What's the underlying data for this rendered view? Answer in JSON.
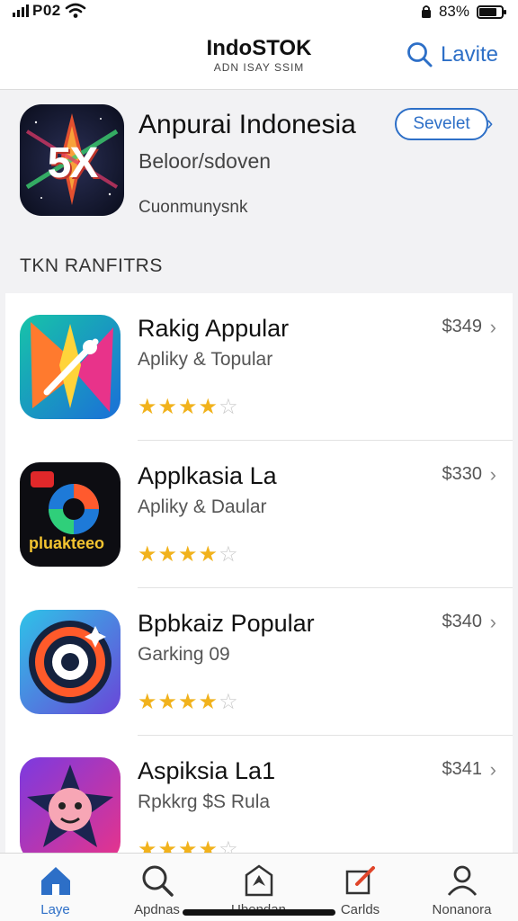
{
  "status_bar": {
    "carrier": "P02",
    "battery_text": "83%",
    "icons": [
      "signal-icon",
      "wifi-icon",
      "lock-icon",
      "battery-icon"
    ]
  },
  "header": {
    "title": "IndoSTOK",
    "subtitle": "ADN ISAY SSIM",
    "search_label": "Lavite",
    "icon": "search-icon"
  },
  "featured": {
    "name": "Anpurai Indonesia",
    "subtitle": "Beloor/sdoven",
    "category": "Cuonmunysnk",
    "button_label": "Sevelet",
    "icon_text": "5X"
  },
  "section_title": "TKN RANFITRS",
  "apps": [
    {
      "name": "Rakig Appular",
      "subtitle": "Apliky & Topular",
      "price": "$349",
      "rating": 4
    },
    {
      "name": "Applkasia La",
      "subtitle": "Apliky & Daular",
      "price": "$330",
      "rating": 4
    },
    {
      "name": "Bpbkaiz Popular",
      "subtitle": "Garking 09",
      "price": "$340",
      "rating": 4
    },
    {
      "name": "Aspiksia La1",
      "subtitle": "Rpkkrg $S Rula",
      "price": "$341",
      "rating": 4
    }
  ],
  "tabs": [
    {
      "label": "Laye",
      "icon": "home-icon",
      "active": true
    },
    {
      "label": "Apdnas",
      "icon": "search-icon",
      "active": false
    },
    {
      "label": "Ubendan",
      "icon": "apps-icon",
      "active": false
    },
    {
      "label": "Carlds",
      "icon": "edit-icon",
      "active": false
    },
    {
      "label": "Nonanora",
      "icon": "profile-icon",
      "active": false
    }
  ],
  "colors": {
    "accent": "#2d6fc7",
    "star": "#f1b21c",
    "background": "#f2f2f4"
  }
}
